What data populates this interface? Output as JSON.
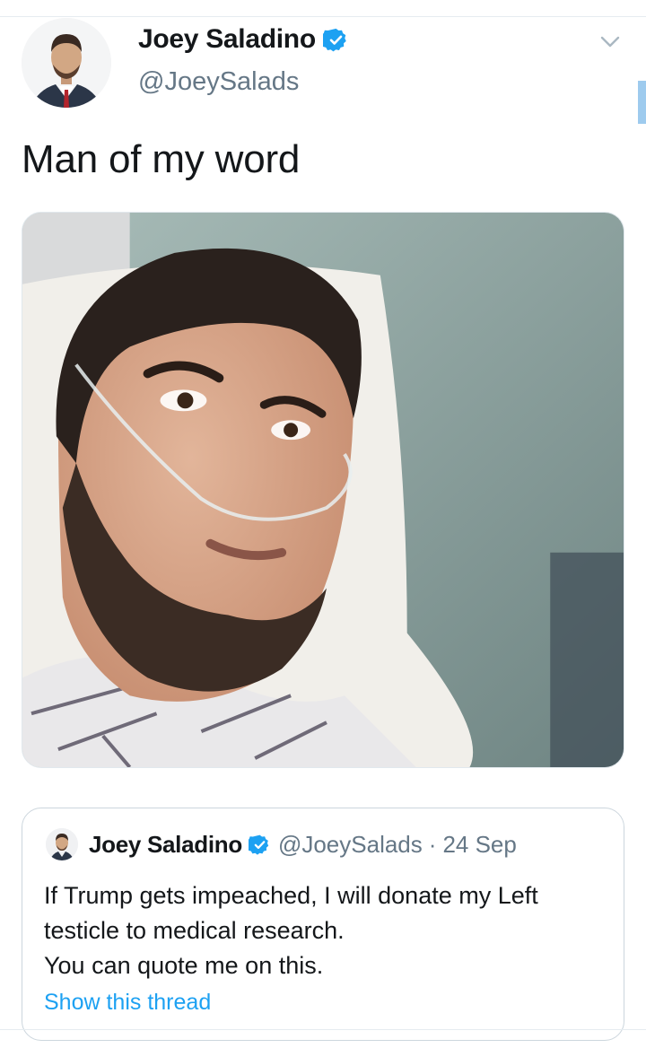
{
  "tweet": {
    "display_name": "Joey Saladino",
    "handle": "@JoeySalads",
    "text": "Man of my word",
    "icons": {
      "verified": "verified-badge-icon",
      "menu": "chevron-down-icon"
    }
  },
  "quoted_tweet": {
    "display_name": "Joey Saladino",
    "handle": "@JoeySalads",
    "separator": "·",
    "date": "24 Sep",
    "lines": [
      "If Trump gets impeached, I will donate my Left",
      "testicle to medical research.",
      "You can quote me on this."
    ],
    "show_thread": "Show this thread"
  },
  "colors": {
    "accent": "#1da1f2",
    "verified": "#1da1f2",
    "secondary_text": "#657786",
    "primary_text": "#14171a",
    "border": "#ccd6dd"
  }
}
